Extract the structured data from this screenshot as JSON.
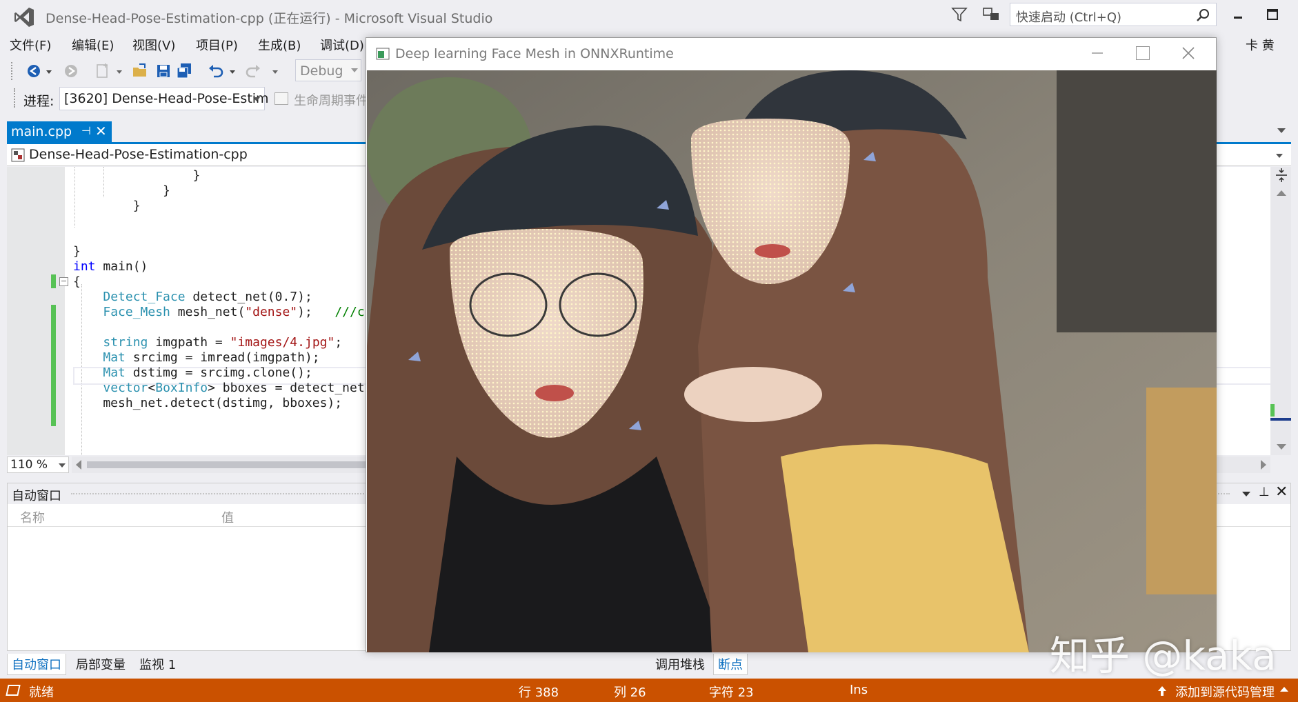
{
  "window": {
    "title": "Dense-Head-Pose-Estimation-cpp (正在运行) - Microsoft Visual Studio",
    "quick_launch_placeholder": "快速启动 (Ctrl+Q)",
    "user": "卡 黄"
  },
  "menu": [
    "文件(F)",
    "编辑(E)",
    "视图(V)",
    "项目(P)",
    "生成(B)",
    "调试(D)"
  ],
  "toolbar": {
    "configuration": "Debug"
  },
  "process": {
    "label": "进程:",
    "value": "[3620] Dense-Head-Pose-Estim",
    "lifecycle_label": "生命周期事件"
  },
  "editor": {
    "tab": "main.cpp",
    "navigation_project": "Dense-Head-Pose-Estimation-cpp",
    "zoom": "110 %",
    "lines": [
      {
        "segments": [
          {
            "t": "                }",
            "c": ""
          }
        ]
      },
      {
        "segments": [
          {
            "t": "            }",
            "c": ""
          }
        ]
      },
      {
        "segments": [
          {
            "t": "        }",
            "c": ""
          }
        ]
      },
      {
        "segments": [
          {
            "t": "",
            "c": ""
          }
        ]
      },
      {
        "segments": [
          {
            "t": "",
            "c": ""
          }
        ]
      },
      {
        "segments": [
          {
            "t": "}",
            "c": ""
          }
        ]
      },
      {
        "segments": [
          {
            "t": "int",
            "c": "kw"
          },
          {
            "t": " main()",
            "c": ""
          }
        ]
      },
      {
        "segments": [
          {
            "t": "{",
            "c": ""
          }
        ]
      },
      {
        "segments": [
          {
            "t": "    ",
            "c": ""
          },
          {
            "t": "Detect_Face",
            "c": "ty"
          },
          {
            "t": " detect_net(0.7);",
            "c": ""
          }
        ]
      },
      {
        "segments": [
          {
            "t": "    ",
            "c": ""
          },
          {
            "t": "Face_Mesh",
            "c": "ty"
          },
          {
            "t": " mesh_net(",
            "c": ""
          },
          {
            "t": "\"dense\"",
            "c": "str"
          },
          {
            "t": ");   ",
            "c": ""
          },
          {
            "t": "///ch",
            "c": "cm"
          }
        ]
      },
      {
        "segments": [
          {
            "t": "",
            "c": ""
          }
        ]
      },
      {
        "segments": [
          {
            "t": "    ",
            "c": ""
          },
          {
            "t": "string",
            "c": "ty"
          },
          {
            "t": " imgpath = ",
            "c": ""
          },
          {
            "t": "\"images/4.jpg\"",
            "c": "str"
          },
          {
            "t": ";",
            "c": ""
          }
        ]
      },
      {
        "segments": [
          {
            "t": "    ",
            "c": ""
          },
          {
            "t": "Mat",
            "c": "ty"
          },
          {
            "t": " srcimg = imread(imgpath);",
            "c": ""
          }
        ]
      },
      {
        "segments": [
          {
            "t": "    ",
            "c": ""
          },
          {
            "t": "Mat",
            "c": "ty"
          },
          {
            "t": " dstimg = srcimg.clone();",
            "c": ""
          }
        ]
      },
      {
        "segments": [
          {
            "t": "    ",
            "c": ""
          },
          {
            "t": "vector",
            "c": "ty"
          },
          {
            "t": "<",
            "c": ""
          },
          {
            "t": "BoxInfo",
            "c": "ty"
          },
          {
            "t": "> bboxes = detect_net.",
            "c": ""
          }
        ]
      },
      {
        "segments": [
          {
            "t": "    mesh_net.detect(dstimg, bboxes);",
            "c": ""
          }
        ]
      }
    ]
  },
  "autos": {
    "title": "自动窗口",
    "column_name": "名称",
    "column_value": "值"
  },
  "bottom_tabs": {
    "left": [
      "自动窗口",
      "局部变量",
      "监视 1"
    ],
    "right": [
      "调用堆栈",
      "断点"
    ]
  },
  "status": {
    "ready": "就绪",
    "line": "行 388",
    "col": "列 26",
    "char": "字符 23",
    "mode": "Ins",
    "source_control": "添加到源代码管理"
  },
  "face_window": {
    "title": "Deep learning Face Mesh in ONNXRuntime"
  },
  "watermark": "知乎 @kaka",
  "colors": {
    "accent": "#007acc",
    "statusbar": "#ca5100",
    "mesh": "#fff6c8"
  }
}
